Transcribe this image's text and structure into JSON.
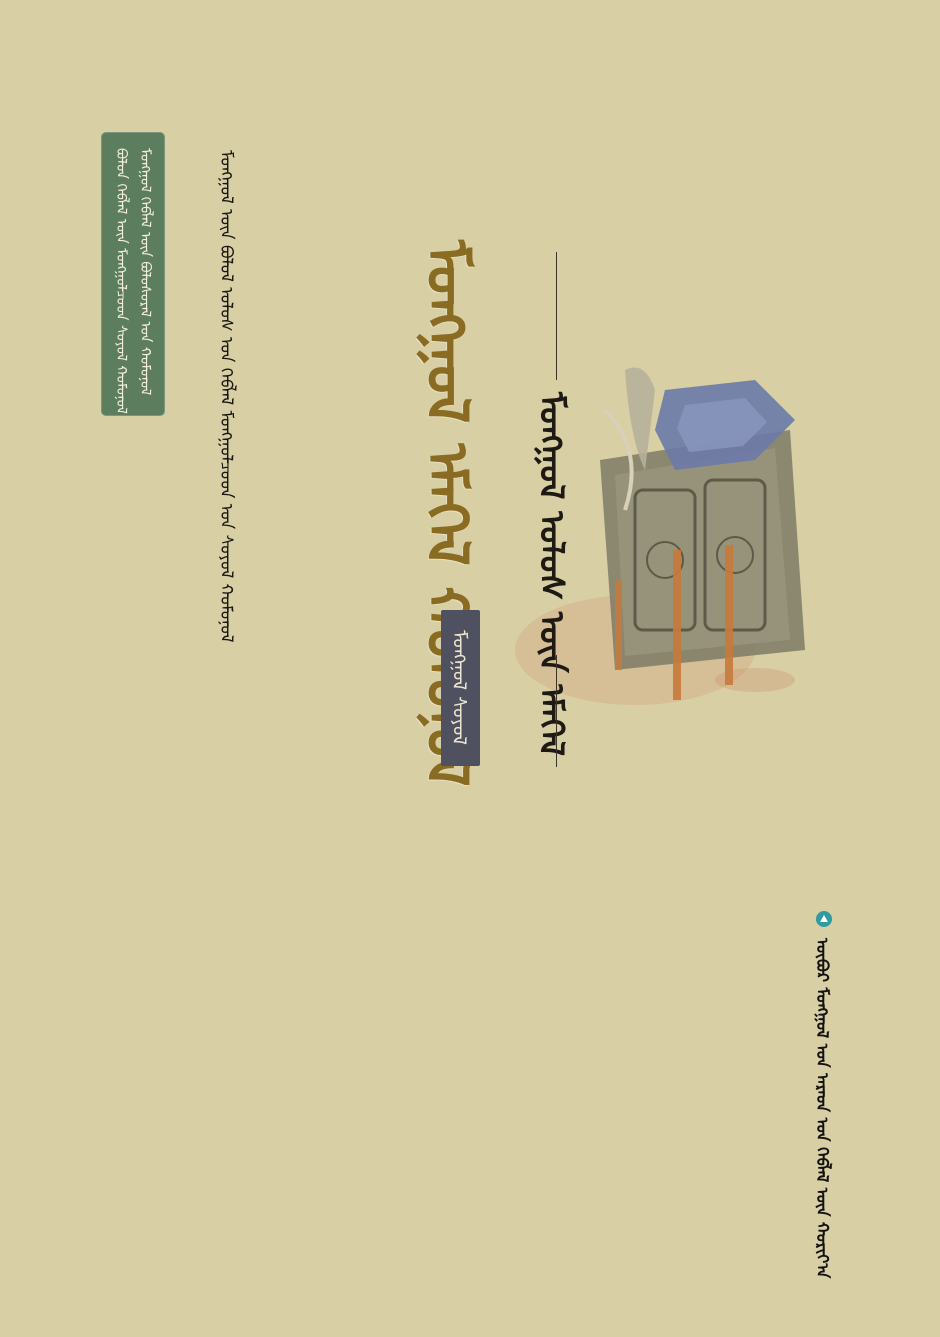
{
  "cover": {
    "title": "ᠮᠣᠩᠭᠣᠯ ᠡᠮᠡᠭᠡᠯ ᠬᠣᠮᠣᠨᠣᠯ",
    "series": "ᠮᠣᠩᠭᠣᠯ ᠰᠤᠶᠤᠯ",
    "subtitle": "ᠮᠣᠩᠭᠣᠯ ᠤᠯᠤᠰ ᠦᠨ ᠡᠮᠡᠭᠡᠯ",
    "author_line": "ᠮᠣᠩᠭᠣᠯ ᠦᠨ ᠪᠣᠯᠣᠯ ᠤᠯᠤᠰ ᠤᠨ ᠬᠡᠪᠯᠡᠯ ᠮᠣᠩᠭᠣᠯᠴᠤᠳ ᠤᠨ ᠰᠤᠶᠤᠯ ᠬᠣᠮᠣᠨᠣᠯ",
    "label_line_1": "ᠪᠣᠯᠣᠨ ᠬᠡᠪᠯᠡᠯ ᠦᠨ ᠮᠣᠩᠭᠣᠯᠴᠤᠳ ᠰᠤᠶᠤᠯ ᠬᠣᠮᠣᠨᠣᠯ",
    "label_line_2": "ᠮᠣᠩᠭᠣᠯ ᠬᠡᠪᠯᠡᠯ ᠦᠨ ᠪᠣᠯᠣᠰᠤᠷᠠᠯ ᠤᠨ ᠬᠣᠮᠣᠨᠣᠯ",
    "publisher": "ᠥᠪᠦᠷ ᠮᠣᠩᠭᠣᠯ ᠤᠨ ᠠᠷᠠᠳ ᠤᠨ ᠬᠡᠪᠯᠡᠯ ᠦᠨ ᠬᠣᠷᠢᠶ᠎ᠠ"
  },
  "colors": {
    "background": "#d8cfa4",
    "title": "#8a6b22",
    "series_badge": "#4f5060",
    "green_label": "#5c7e5e"
  },
  "icons": {
    "publisher_logo": "publisher-logo-icon",
    "saddle": "saddle-illustration"
  }
}
